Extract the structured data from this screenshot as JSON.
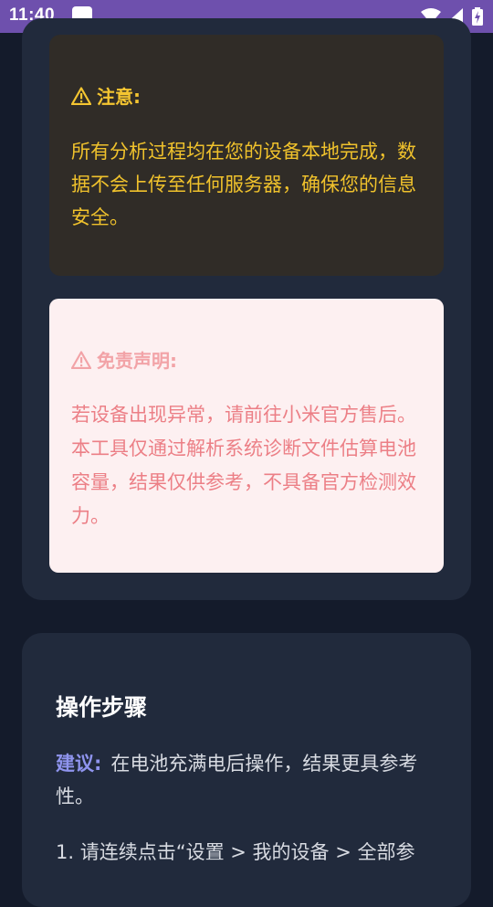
{
  "status_bar": {
    "time": "11:40",
    "icons": [
      "app-notification-icon",
      "wifi-icon",
      "signal-icon",
      "battery-charging-icon"
    ],
    "color": "#6e50ad"
  },
  "notice": {
    "title": "注意:",
    "icon": "warning-icon",
    "body": "所有分析过程均在您的设备本地完成，数据不会上传至任何服务器，确保您的信息安全。",
    "color": "#f0c22c"
  },
  "disclaimer": {
    "title": "免责声明:",
    "icon": "warning-icon",
    "body": "若设备出现异常，请前往小米官方售后。本工具仅通过解析系统诊断文件估算电池容量，结果仅供参考，不具备官方检测效力。",
    "color": "#ec7f86"
  },
  "steps": {
    "title": "操作步骤",
    "suggestion_label": "建议:",
    "suggestion_text": "在电池充满电后操作，结果更具参考性。",
    "step1": "1. 请连续点击“设置 > 我的设备 > 全部参"
  }
}
